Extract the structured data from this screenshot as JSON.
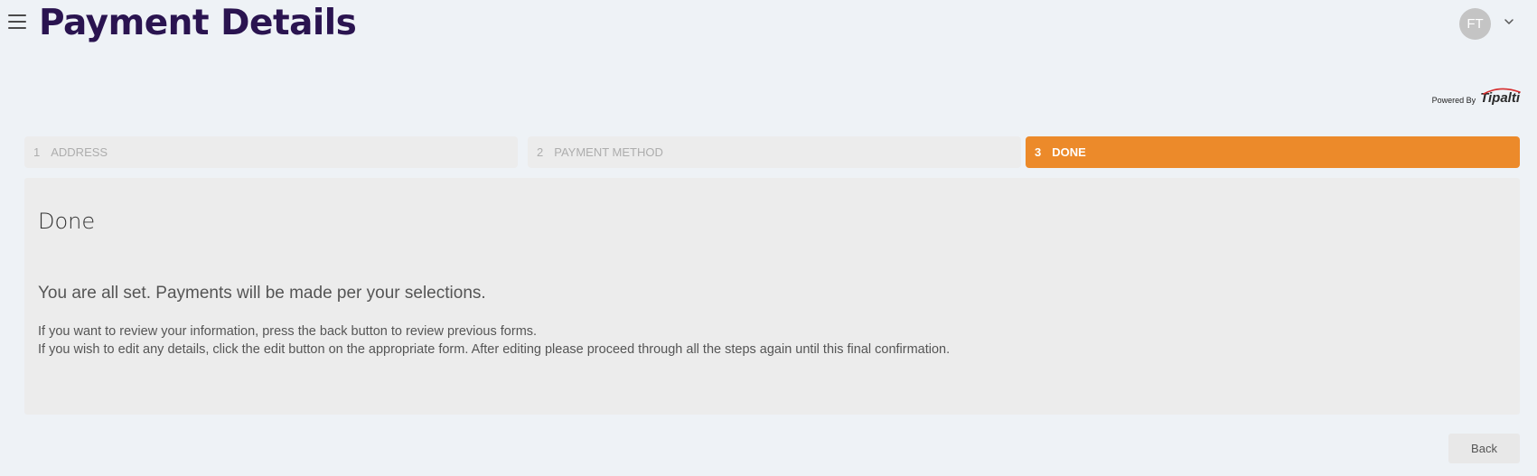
{
  "header": {
    "title": "Payment Details",
    "menu_icon": "hamburger-menu-icon",
    "user_initials": "FT",
    "user_menu_icon": "chevron-down-icon"
  },
  "branding": {
    "powered_by": "Powered By",
    "logo_text": "Tipalti"
  },
  "steps": [
    {
      "number": "1",
      "label": "ADDRESS",
      "active": false
    },
    {
      "number": "2",
      "label": "PAYMENT METHOD",
      "active": false
    },
    {
      "number": "3",
      "label": "DONE",
      "active": true
    }
  ],
  "panel": {
    "title": "Done",
    "message": "You are all set. Payments will be made per your selections.",
    "info_lines": [
      "If you want to review your information, press the back button to review previous forms.",
      "If you wish to edit any details, click the edit button on the appropriate form. After editing please proceed through all the steps again until this final confirmation."
    ]
  },
  "footer": {
    "back_label": "Back"
  },
  "colors": {
    "background": "#eef2f6",
    "title": "#2a1450",
    "active_step": "#ec8a2a",
    "inactive_step": "#ececec",
    "logo_accent": "#d62b2b"
  }
}
